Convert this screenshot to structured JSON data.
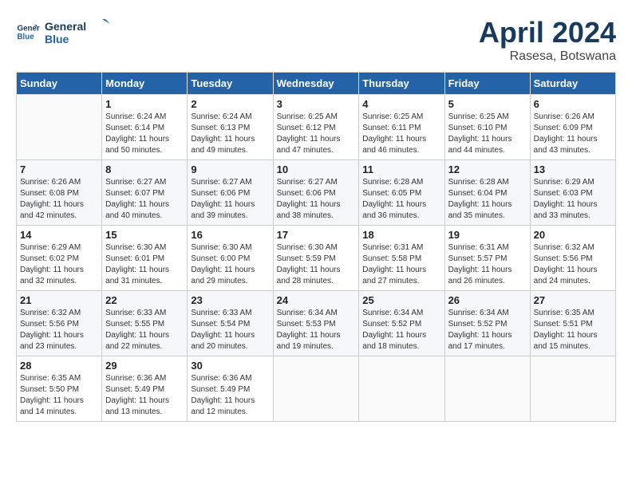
{
  "header": {
    "logo_line1": "General",
    "logo_line2": "Blue",
    "month_title": "April 2024",
    "subtitle": "Rasesa, Botswana"
  },
  "weekdays": [
    "Sunday",
    "Monday",
    "Tuesday",
    "Wednesday",
    "Thursday",
    "Friday",
    "Saturday"
  ],
  "weeks": [
    [
      {
        "day": "",
        "sunrise": "",
        "sunset": "",
        "daylight": ""
      },
      {
        "day": "1",
        "sunrise": "Sunrise: 6:24 AM",
        "sunset": "Sunset: 6:14 PM",
        "daylight": "Daylight: 11 hours and 50 minutes."
      },
      {
        "day": "2",
        "sunrise": "Sunrise: 6:24 AM",
        "sunset": "Sunset: 6:13 PM",
        "daylight": "Daylight: 11 hours and 49 minutes."
      },
      {
        "day": "3",
        "sunrise": "Sunrise: 6:25 AM",
        "sunset": "Sunset: 6:12 PM",
        "daylight": "Daylight: 11 hours and 47 minutes."
      },
      {
        "day": "4",
        "sunrise": "Sunrise: 6:25 AM",
        "sunset": "Sunset: 6:11 PM",
        "daylight": "Daylight: 11 hours and 46 minutes."
      },
      {
        "day": "5",
        "sunrise": "Sunrise: 6:25 AM",
        "sunset": "Sunset: 6:10 PM",
        "daylight": "Daylight: 11 hours and 44 minutes."
      },
      {
        "day": "6",
        "sunrise": "Sunrise: 6:26 AM",
        "sunset": "Sunset: 6:09 PM",
        "daylight": "Daylight: 11 hours and 43 minutes."
      }
    ],
    [
      {
        "day": "7",
        "sunrise": "Sunrise: 6:26 AM",
        "sunset": "Sunset: 6:08 PM",
        "daylight": "Daylight: 11 hours and 42 minutes."
      },
      {
        "day": "8",
        "sunrise": "Sunrise: 6:27 AM",
        "sunset": "Sunset: 6:07 PM",
        "daylight": "Daylight: 11 hours and 40 minutes."
      },
      {
        "day": "9",
        "sunrise": "Sunrise: 6:27 AM",
        "sunset": "Sunset: 6:06 PM",
        "daylight": "Daylight: 11 hours and 39 minutes."
      },
      {
        "day": "10",
        "sunrise": "Sunrise: 6:27 AM",
        "sunset": "Sunset: 6:06 PM",
        "daylight": "Daylight: 11 hours and 38 minutes."
      },
      {
        "day": "11",
        "sunrise": "Sunrise: 6:28 AM",
        "sunset": "Sunset: 6:05 PM",
        "daylight": "Daylight: 11 hours and 36 minutes."
      },
      {
        "day": "12",
        "sunrise": "Sunrise: 6:28 AM",
        "sunset": "Sunset: 6:04 PM",
        "daylight": "Daylight: 11 hours and 35 minutes."
      },
      {
        "day": "13",
        "sunrise": "Sunrise: 6:29 AM",
        "sunset": "Sunset: 6:03 PM",
        "daylight": "Daylight: 11 hours and 33 minutes."
      }
    ],
    [
      {
        "day": "14",
        "sunrise": "Sunrise: 6:29 AM",
        "sunset": "Sunset: 6:02 PM",
        "daylight": "Daylight: 11 hours and 32 minutes."
      },
      {
        "day": "15",
        "sunrise": "Sunrise: 6:30 AM",
        "sunset": "Sunset: 6:01 PM",
        "daylight": "Daylight: 11 hours and 31 minutes."
      },
      {
        "day": "16",
        "sunrise": "Sunrise: 6:30 AM",
        "sunset": "Sunset: 6:00 PM",
        "daylight": "Daylight: 11 hours and 29 minutes."
      },
      {
        "day": "17",
        "sunrise": "Sunrise: 6:30 AM",
        "sunset": "Sunset: 5:59 PM",
        "daylight": "Daylight: 11 hours and 28 minutes."
      },
      {
        "day": "18",
        "sunrise": "Sunrise: 6:31 AM",
        "sunset": "Sunset: 5:58 PM",
        "daylight": "Daylight: 11 hours and 27 minutes."
      },
      {
        "day": "19",
        "sunrise": "Sunrise: 6:31 AM",
        "sunset": "Sunset: 5:57 PM",
        "daylight": "Daylight: 11 hours and 26 minutes."
      },
      {
        "day": "20",
        "sunrise": "Sunrise: 6:32 AM",
        "sunset": "Sunset: 5:56 PM",
        "daylight": "Daylight: 11 hours and 24 minutes."
      }
    ],
    [
      {
        "day": "21",
        "sunrise": "Sunrise: 6:32 AM",
        "sunset": "Sunset: 5:56 PM",
        "daylight": "Daylight: 11 hours and 23 minutes."
      },
      {
        "day": "22",
        "sunrise": "Sunrise: 6:33 AM",
        "sunset": "Sunset: 5:55 PM",
        "daylight": "Daylight: 11 hours and 22 minutes."
      },
      {
        "day": "23",
        "sunrise": "Sunrise: 6:33 AM",
        "sunset": "Sunset: 5:54 PM",
        "daylight": "Daylight: 11 hours and 20 minutes."
      },
      {
        "day": "24",
        "sunrise": "Sunrise: 6:34 AM",
        "sunset": "Sunset: 5:53 PM",
        "daylight": "Daylight: 11 hours and 19 minutes."
      },
      {
        "day": "25",
        "sunrise": "Sunrise: 6:34 AM",
        "sunset": "Sunset: 5:52 PM",
        "daylight": "Daylight: 11 hours and 18 minutes."
      },
      {
        "day": "26",
        "sunrise": "Sunrise: 6:34 AM",
        "sunset": "Sunset: 5:52 PM",
        "daylight": "Daylight: 11 hours and 17 minutes."
      },
      {
        "day": "27",
        "sunrise": "Sunrise: 6:35 AM",
        "sunset": "Sunset: 5:51 PM",
        "daylight": "Daylight: 11 hours and 15 minutes."
      }
    ],
    [
      {
        "day": "28",
        "sunrise": "Sunrise: 6:35 AM",
        "sunset": "Sunset: 5:50 PM",
        "daylight": "Daylight: 11 hours and 14 minutes."
      },
      {
        "day": "29",
        "sunrise": "Sunrise: 6:36 AM",
        "sunset": "Sunset: 5:49 PM",
        "daylight": "Daylight: 11 hours and 13 minutes."
      },
      {
        "day": "30",
        "sunrise": "Sunrise: 6:36 AM",
        "sunset": "Sunset: 5:49 PM",
        "daylight": "Daylight: 11 hours and 12 minutes."
      },
      {
        "day": "",
        "sunrise": "",
        "sunset": "",
        "daylight": ""
      },
      {
        "day": "",
        "sunrise": "",
        "sunset": "",
        "daylight": ""
      },
      {
        "day": "",
        "sunrise": "",
        "sunset": "",
        "daylight": ""
      },
      {
        "day": "",
        "sunrise": "",
        "sunset": "",
        "daylight": ""
      }
    ]
  ]
}
